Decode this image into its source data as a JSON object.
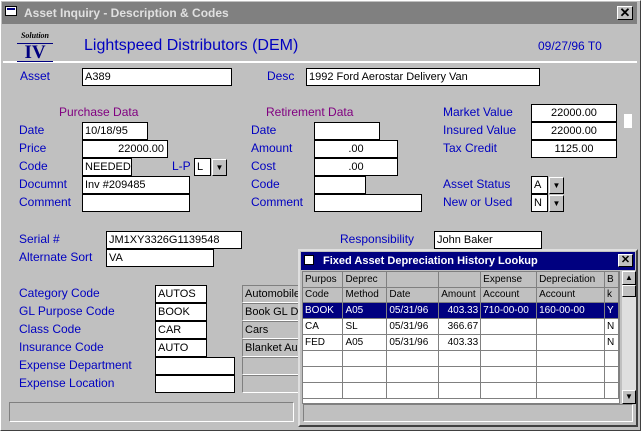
{
  "window": {
    "title": "Asset Inquiry - Description & Codes",
    "close": "✕"
  },
  "header": {
    "logo_top": "Solution",
    "logo_main": "IV",
    "company": "Lightspeed Distributors (DEM)",
    "date": "09/27/96 T0"
  },
  "asset": {
    "label": "Asset",
    "value": "A389",
    "desc_label": "Desc",
    "desc_value": "1992 Ford Aerostar Delivery Van"
  },
  "purchase": {
    "heading": "Purchase Data",
    "date_label": "Date",
    "date": "10/18/95",
    "price_label": "Price",
    "price": "22000.00",
    "code_label": "Code",
    "code": "NEEDED",
    "lp_label": "L-P",
    "lp": "L",
    "document_label": "Documnt",
    "document": "Inv #209485",
    "comment_label": "Comment",
    "comment": ""
  },
  "retirement": {
    "heading": "Retirement Data",
    "date_label": "Date",
    "date": "",
    "amount_label": "Amount",
    "amount": ".00",
    "cost_label": "Cost",
    "cost": ".00",
    "code_label": "Code",
    "code": "",
    "comment_label": "Comment",
    "comment": ""
  },
  "values": {
    "market_label": "Market Value",
    "market": "22000.00",
    "insured_label": "Insured Value",
    "insured": "22000.00",
    "taxcredit_label": "Tax Credit",
    "taxcredit": "1125.00",
    "status_label": "Asset Status",
    "status": "A",
    "newused_label": "New or Used",
    "newused": "N"
  },
  "serial": {
    "label": "Serial #",
    "value": "JM1XY3326G1139548",
    "alt_label": "Alternate Sort",
    "alt_value": "VA",
    "resp_label": "Responsibility",
    "resp_value": "John Baker"
  },
  "codes": {
    "category_label": "Category Code",
    "category": "AUTOS",
    "category_desc": "Automobile",
    "gl_label": "GL Purpose Code",
    "gl": "BOOK",
    "gl_desc": "Book GL D",
    "class_label": "Class Code",
    "class": "CAR",
    "class_desc": "Cars",
    "insurance_label": "Insurance Code",
    "insurance": "AUTO",
    "insurance_desc": "Blanket Au",
    "expdept_label": "Expense Department",
    "expdept": "",
    "exploc_label": "Expense Location",
    "exploc": ""
  },
  "popup": {
    "title": "Fixed Asset Depreciation History Lookup",
    "close": "✕",
    "headers1": [
      "Purpos",
      "Deprec",
      "",
      "",
      "Expense",
      "Depreciation",
      "B"
    ],
    "headers2": [
      "Code",
      "Method",
      "Date",
      "Amount",
      "Account",
      "Account",
      "k"
    ],
    "rows": [
      [
        "BOOK",
        "A05",
        "05/31/96",
        "403.33",
        "710-00-00",
        "160-00-00",
        "Y"
      ],
      [
        "CA",
        "SL",
        "05/31/96",
        "366.67",
        "",
        "",
        "N"
      ],
      [
        "FED",
        "A05",
        "05/31/96",
        "403.33",
        "",
        "",
        "N"
      ]
    ]
  },
  "icons": {
    "down": "▼",
    "up": "▲"
  }
}
